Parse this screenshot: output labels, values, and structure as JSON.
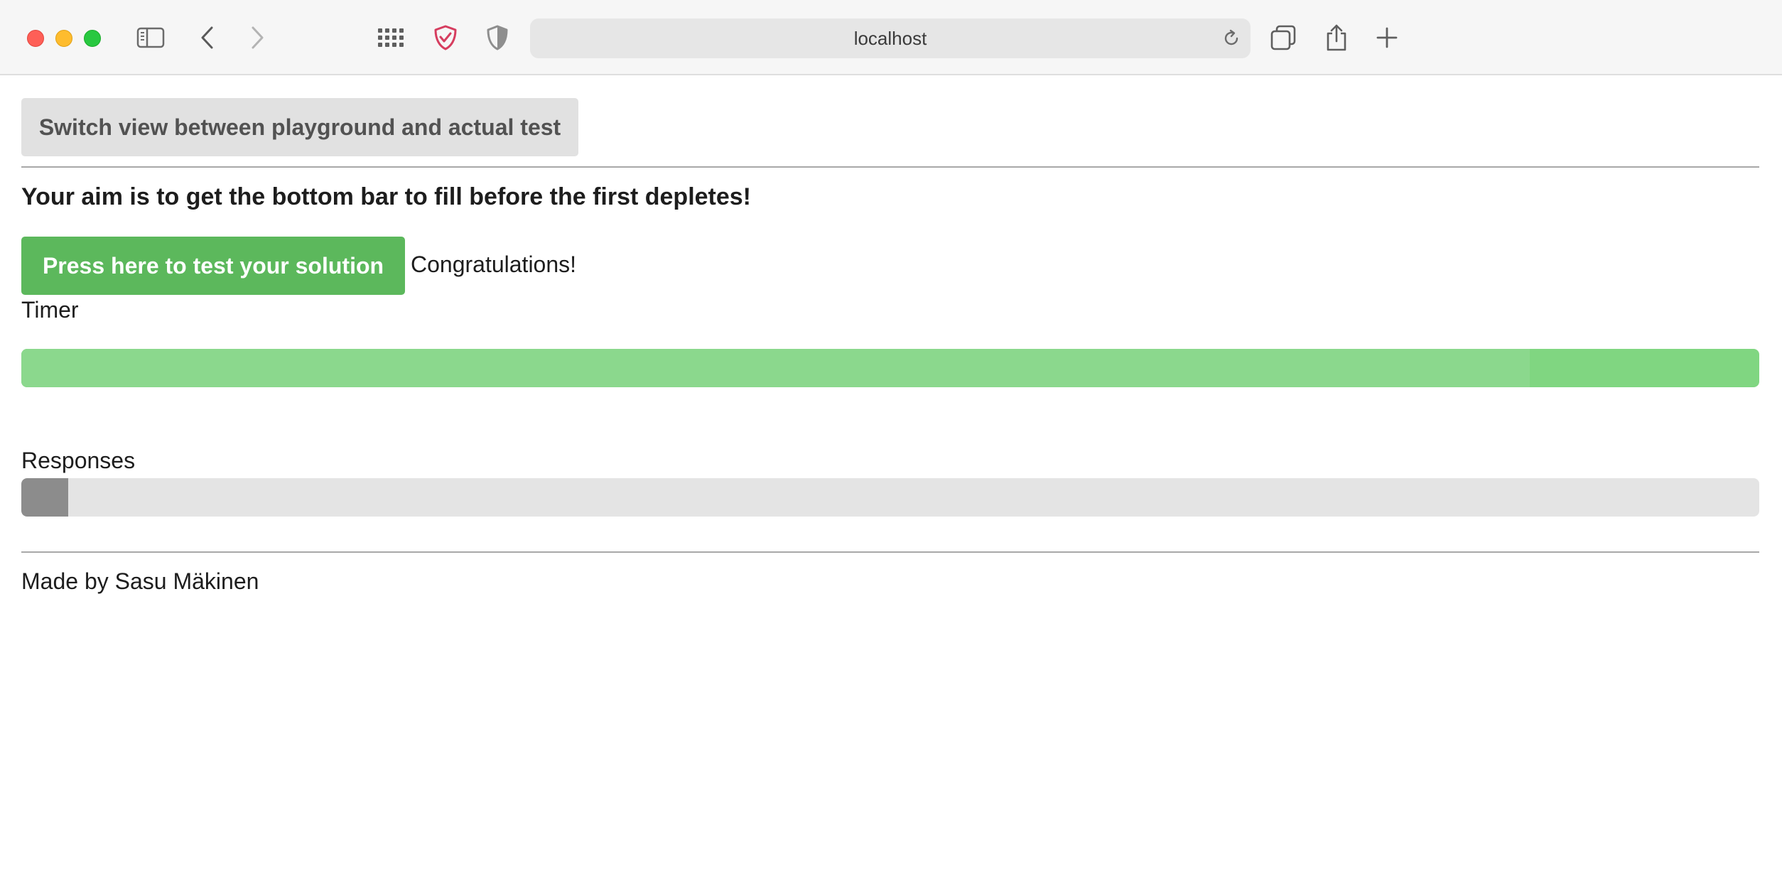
{
  "browser": {
    "address": "localhost",
    "icons": {
      "close": "close-window-icon",
      "minimize": "minimize-window-icon",
      "maximize": "maximize-window-icon",
      "sidebar": "sidebar-icon",
      "back": "chevron-left-icon",
      "forward": "chevron-right-icon",
      "grid": "grid-icon",
      "privacy": "shield-check-icon",
      "shield": "shield-icon",
      "reload": "reload-icon",
      "tabs": "tabs-overview-icon",
      "share": "share-icon",
      "new_tab": "plus-icon"
    }
  },
  "page": {
    "switch_label": "Switch view between playground and actual test",
    "aim_text": "Your aim is to get the bottom bar to fill before the first depletes!",
    "test_button_label": "Press here to test your solution",
    "status_text": "Congratulations!",
    "timer_label": "Timer",
    "timer_fraction": 0.868,
    "responses_label": "Responses",
    "responses_fraction": 0.027,
    "footer_text": "Made by Sasu Mäkinen",
    "colors": {
      "success_green": "#5cb85c",
      "timer_bar": "#8bd88d",
      "responses_fill": "#8c8c8c",
      "track": "#e4e4e4"
    }
  }
}
